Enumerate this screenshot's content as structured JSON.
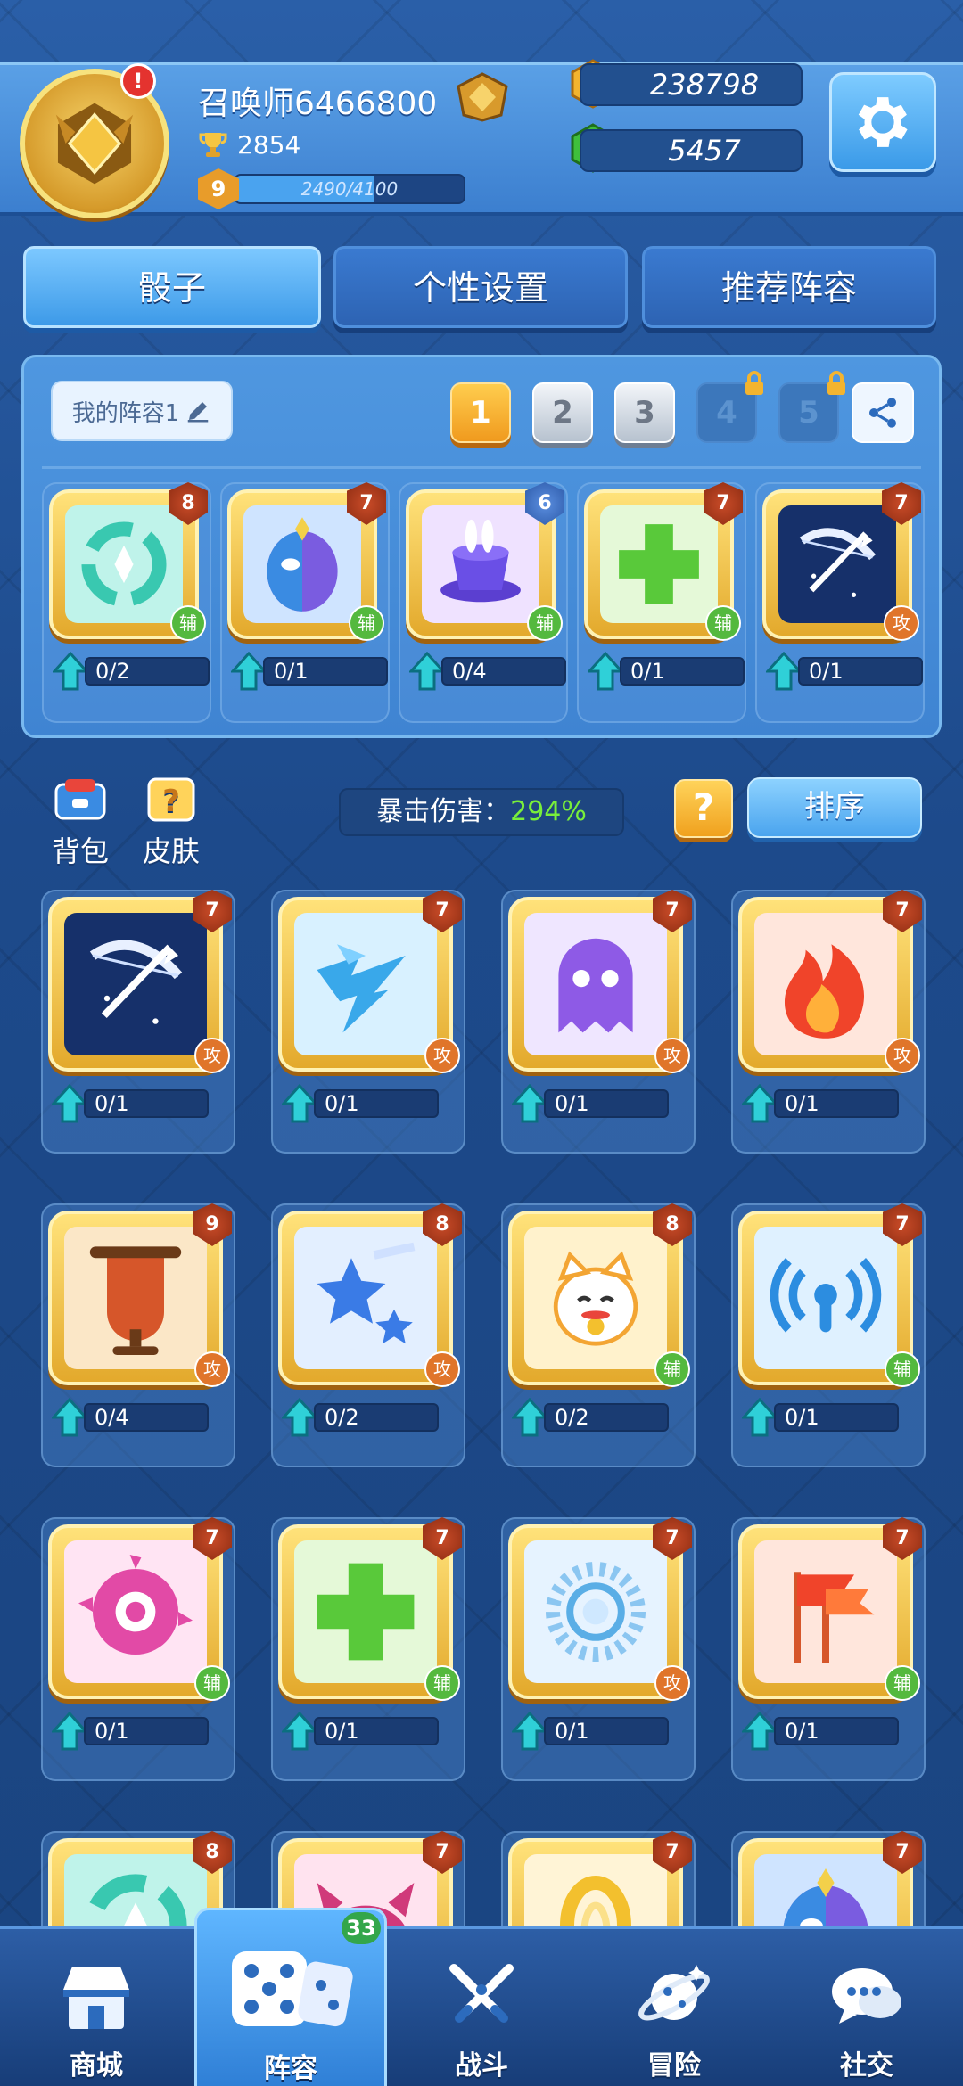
{
  "header": {
    "username": "召唤师6466800",
    "trophies": "2854",
    "level": "9",
    "xp_text": "2490/4100",
    "xp_progress": 0.607,
    "notification": "!",
    "gold": "238798",
    "gems": "5457"
  },
  "tabs": [
    {
      "label": "骰子",
      "active": true
    },
    {
      "label": "个性设置",
      "active": false
    },
    {
      "label": "推荐阵容",
      "active": false
    }
  ],
  "lineup": {
    "name": "我的阵容1",
    "slots": [
      "1",
      "2",
      "3",
      "4",
      "5"
    ],
    "selected_slot": "1",
    "locked_slots": [
      "4",
      "5"
    ],
    "dice": [
      {
        "icon": "swirl-teal-icon",
        "level": "8",
        "type": "辅",
        "progress": "0/2"
      },
      {
        "icon": "mask-purple-icon",
        "level": "7",
        "type": "辅",
        "progress": "0/1"
      },
      {
        "icon": "magic-hat-icon",
        "level": "6",
        "type": "辅",
        "progress": "0/4",
        "level_color": "blue"
      },
      {
        "icon": "green-cross-icon",
        "level": "7",
        "type": "辅",
        "progress": "0/1"
      },
      {
        "icon": "bow-icon",
        "level": "7",
        "type": "攻",
        "progress": "0/1"
      }
    ]
  },
  "middle": {
    "backpack_label": "背包",
    "skin_label": "皮肤",
    "crit_label": "暴击伤害：",
    "crit_value": "294%",
    "help_label": "?",
    "sort_label": "排序"
  },
  "collection": [
    {
      "icon": "bow-icon",
      "level": "7",
      "type": "攻",
      "progress": "0/1"
    },
    {
      "icon": "lightning-icon",
      "level": "7",
      "type": "攻",
      "progress": "0/1"
    },
    {
      "icon": "ghost-icon",
      "level": "7",
      "type": "攻",
      "progress": "0/1"
    },
    {
      "icon": "fire-icon",
      "level": "7",
      "type": "攻",
      "progress": "0/1"
    },
    {
      "icon": "gong-icon",
      "level": "9",
      "type": "攻",
      "progress": "0/4"
    },
    {
      "icon": "star-icon",
      "level": "8",
      "type": "攻",
      "progress": "0/2"
    },
    {
      "icon": "lucky-cat-icon",
      "level": "8",
      "type": "辅",
      "progress": "0/2"
    },
    {
      "icon": "signal-icon",
      "level": "7",
      "type": "辅",
      "progress": "0/1"
    },
    {
      "icon": "eye-icon",
      "level": "7",
      "type": "辅",
      "progress": "0/1"
    },
    {
      "icon": "green-cross-icon",
      "level": "7",
      "type": "辅",
      "progress": "0/1"
    },
    {
      "icon": "sun-icon",
      "level": "7",
      "type": "攻",
      "progress": "0/1"
    },
    {
      "icon": "flag-icon",
      "level": "7",
      "type": "辅",
      "progress": "0/1"
    },
    {
      "icon": "swirl-teal-icon",
      "level": "8",
      "type": "",
      "progress": ""
    },
    {
      "icon": "demon-icon",
      "level": "7",
      "type": "",
      "progress": ""
    },
    {
      "icon": "arc-icon",
      "level": "7",
      "type": "",
      "progress": ""
    },
    {
      "icon": "mask-purple-icon",
      "level": "7",
      "type": "",
      "progress": ""
    }
  ],
  "bottom_nav": [
    {
      "label": "商城",
      "icon": "shop-icon",
      "active": false
    },
    {
      "label": "阵容",
      "icon": "dice-icon",
      "active": true,
      "badge": "33"
    },
    {
      "label": "战斗",
      "icon": "swords-icon",
      "active": false
    },
    {
      "label": "冒险",
      "icon": "planet-icon",
      "active": false
    },
    {
      "label": "社交",
      "icon": "chat-icon",
      "active": false
    }
  ],
  "colors": {
    "background": "#1f4d8c",
    "accent": "#4aa4ee",
    "gold": "#f0a11e",
    "attack": "#e0752a",
    "support": "#54b93e",
    "crit_value": "#79ef3a"
  }
}
